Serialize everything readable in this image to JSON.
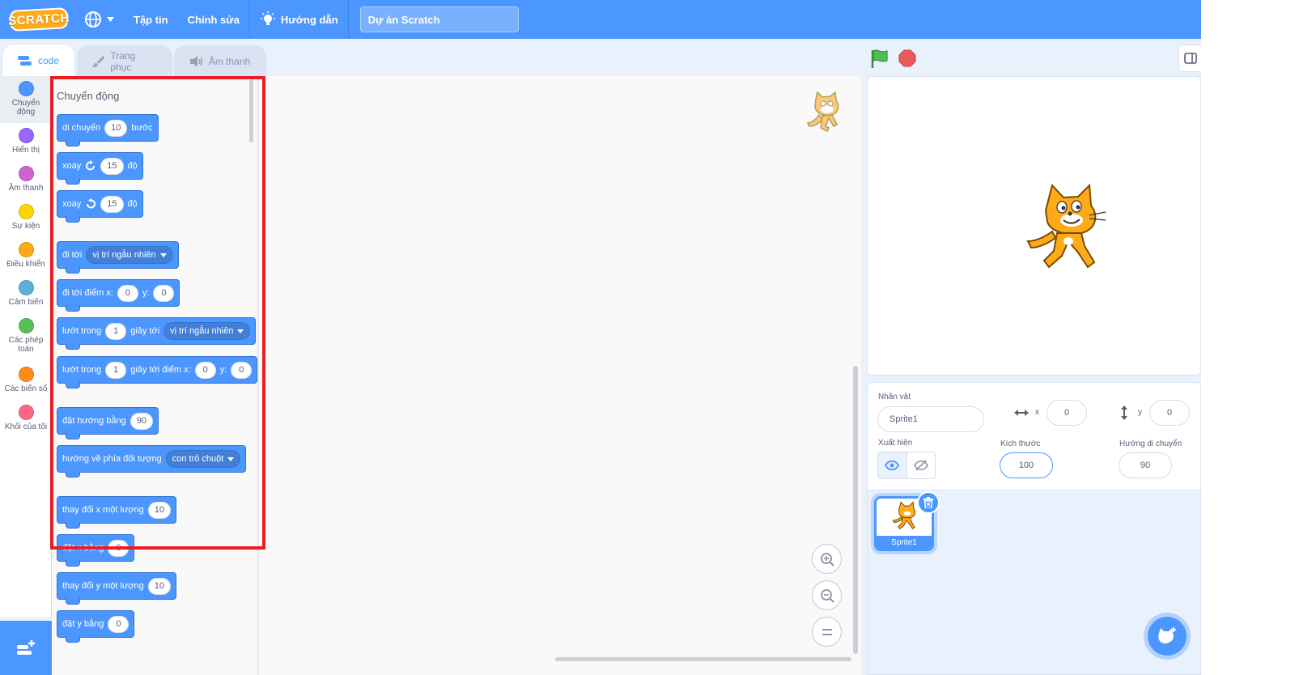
{
  "menubar": {
    "logo": "SCRATCH",
    "file": "Tập tin",
    "edit": "Chỉnh sửa",
    "tutorials": "Hướng dẫn",
    "project_title": "Dự án Scratch"
  },
  "tabs": {
    "code": "code",
    "costumes": "Trang phục",
    "sounds": "Âm thanh"
  },
  "categories": [
    {
      "label": "Chuyển động",
      "color": "#4c97ff"
    },
    {
      "label": "Hiển thị",
      "color": "#9966ff"
    },
    {
      "label": "Âm thanh",
      "color": "#cf63cf"
    },
    {
      "label": "Sự kiện",
      "color": "#ffd500"
    },
    {
      "label": "Điều khiển",
      "color": "#ffab19"
    },
    {
      "label": "Cảm biến",
      "color": "#5cb1d6"
    },
    {
      "label": "Các phép toán",
      "color": "#59c059"
    },
    {
      "label": "Các biến số",
      "color": "#ff8c1a"
    },
    {
      "label": "Khối của tôi",
      "color": "#ff6680"
    }
  ],
  "flyout": {
    "heading": "Chuyển động",
    "blocks": {
      "move": {
        "t1": "di chuyển",
        "v1": "10",
        "t2": "bước"
      },
      "turn_right": {
        "t1": "xoay",
        "v1": "15",
        "t2": "độ"
      },
      "turn_left": {
        "t1": "xoay",
        "v1": "15",
        "t2": "độ"
      },
      "goto": {
        "t1": "đi tới",
        "d1": "vị trí ngẫu nhiên"
      },
      "goto_xy": {
        "t1": "đi tới điểm x:",
        "v1": "0",
        "t2": "y:",
        "v2": "0"
      },
      "glide_to": {
        "t1": "lướt trong",
        "v1": "1",
        "t2": "giây tới",
        "d1": "vị trí ngẫu nhiên"
      },
      "glide_xy": {
        "t1": "lướt trong",
        "v1": "1",
        "t2": "giây tới điểm x:",
        "v2": "0",
        "t3": "y:",
        "v3": "0"
      },
      "point_dir": {
        "t1": "đặt hướng bằng",
        "v1": "90"
      },
      "point_towards": {
        "t1": "hướng về phía đối tượng",
        "d1": "con trỏ chuột"
      },
      "change_x": {
        "t1": "thay đổi x một lượng",
        "v1": "10"
      },
      "set_x": {
        "t1": "đặt x bằng",
        "v1": "0"
      },
      "change_y": {
        "t1": "thay đổi y một lượng",
        "v1": "10"
      },
      "set_y": {
        "t1": "đặt y bằng",
        "v1": "0"
      }
    }
  },
  "sprite_info": {
    "sprite_label": "Nhân vật",
    "sprite_name": "Sprite1",
    "x_label": "x",
    "x_value": "0",
    "y_label": "y",
    "y_value": "0",
    "show_label": "Xuất hiện",
    "size_label": "Kích thước",
    "size_value": "100",
    "direction_label": "Hướng di chuyển",
    "direction_value": "90"
  },
  "sprite_list": {
    "sprites": [
      {
        "name": "Sprite1"
      }
    ]
  },
  "colors": {
    "menubar": "#4c97ff",
    "motion": "#4c97ff",
    "highlight": "#ec1c24"
  }
}
